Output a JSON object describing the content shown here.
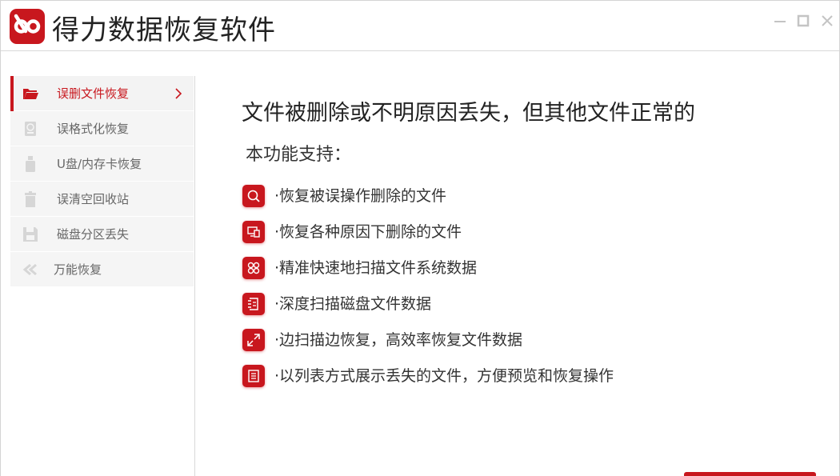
{
  "app": {
    "title": "得力数据恢复软件",
    "accent_color": "#c8171e",
    "logo_icon": "infinity-logo-icon"
  },
  "window_controls": {
    "minimize_icon": "minimize-icon",
    "maximize_icon": "maximize-icon",
    "close_icon": "close-icon"
  },
  "sidebar": {
    "items": [
      {
        "label": "误删文件恢复",
        "icon": "folder-icon",
        "active": true
      },
      {
        "label": "误格式化恢复",
        "icon": "drive-format-icon",
        "active": false
      },
      {
        "label": "U盘/内存卡恢复",
        "icon": "usb-drive-icon",
        "active": false
      },
      {
        "label": "误清空回收站",
        "icon": "trash-icon",
        "active": false
      },
      {
        "label": "磁盘分区丢失",
        "icon": "floppy-disk-icon",
        "active": false
      },
      {
        "label": "万能恢复",
        "icon": "double-arrow-icon",
        "active": false
      }
    ]
  },
  "main": {
    "heading": "文件被删除或不明原因丢失，但其他文件正常的",
    "subheading": "本功能支持：",
    "features": [
      {
        "text": "·恢复被误操作删除的文件",
        "icon": "search-icon"
      },
      {
        "text": "·恢复各种原因下删除的文件",
        "icon": "devices-icon"
      },
      {
        "text": "·精准快速地扫描文件系统数据",
        "icon": "grid-icon"
      },
      {
        "text": "·深度扫描磁盘文件数据",
        "icon": "document-scan-icon"
      },
      {
        "text": "·边扫描边恢复，高效率恢复文件数据",
        "icon": "expand-arrows-icon"
      },
      {
        "text": "·以列表方式展示丢失的文件，方便预览和恢复操作",
        "icon": "list-document-icon"
      }
    ]
  }
}
